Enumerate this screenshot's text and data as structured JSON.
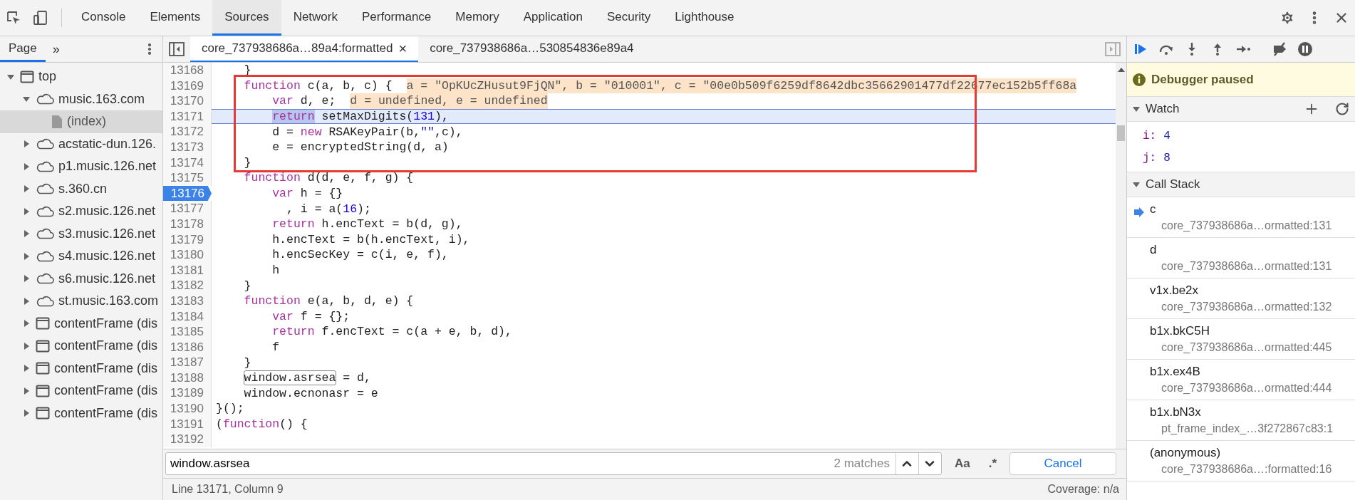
{
  "main_tabs": [
    {
      "label": "Console",
      "selected": false
    },
    {
      "label": "Elements",
      "selected": false
    },
    {
      "label": "Sources",
      "selected": true
    },
    {
      "label": "Network",
      "selected": false
    },
    {
      "label": "Performance",
      "selected": false
    },
    {
      "label": "Memory",
      "selected": false
    },
    {
      "label": "Application",
      "selected": false
    },
    {
      "label": "Security",
      "selected": false
    },
    {
      "label": "Lighthouse",
      "selected": false
    }
  ],
  "navigator": {
    "tab": {
      "label": "Page",
      "selected": true
    },
    "more_tabs": "»",
    "tree": [
      {
        "label": "top",
        "kind": "frame",
        "expanded": true,
        "selected": false,
        "children": [
          {
            "label": "music.163.com",
            "kind": "cloud",
            "expanded": true,
            "selected": false,
            "children": [
              {
                "label": "(index)",
                "kind": "file",
                "selected": true
              }
            ]
          },
          {
            "label": "acstatic-dun.126.",
            "kind": "cloud",
            "expanded": false,
            "selected": false
          },
          {
            "label": "p1.music.126.net",
            "kind": "cloud",
            "expanded": false,
            "selected": false
          },
          {
            "label": "s.360.cn",
            "kind": "cloud",
            "expanded": false,
            "selected": false
          },
          {
            "label": "s2.music.126.net",
            "kind": "cloud",
            "expanded": false,
            "selected": false
          },
          {
            "label": "s3.music.126.net",
            "kind": "cloud",
            "expanded": false,
            "selected": false
          },
          {
            "label": "s4.music.126.net",
            "kind": "cloud",
            "expanded": false,
            "selected": false
          },
          {
            "label": "s6.music.126.net",
            "kind": "cloud",
            "expanded": false,
            "selected": false
          },
          {
            "label": "st.music.163.com",
            "kind": "cloud",
            "expanded": false,
            "selected": false
          },
          {
            "label": "contentFrame (dis",
            "kind": "frame",
            "expanded": false,
            "selected": false
          },
          {
            "label": "contentFrame (dis",
            "kind": "frame",
            "expanded": false,
            "selected": false
          },
          {
            "label": "contentFrame (dis",
            "kind": "frame",
            "expanded": false,
            "selected": false
          },
          {
            "label": "contentFrame (dis",
            "kind": "frame",
            "expanded": false,
            "selected": false
          },
          {
            "label": "contentFrame (dis",
            "kind": "frame",
            "expanded": false,
            "selected": false
          }
        ]
      }
    ]
  },
  "editor_tabs": [
    {
      "label": "core_737938686a…89a4:formatted",
      "selected": true,
      "close": "×"
    },
    {
      "label": "core_737938686a…530854836e89a4",
      "selected": false
    }
  ],
  "lines": [
    {
      "number": "13168",
      "current": false,
      "breakpoint": false,
      "segments": [
        {
          "kind": "plain",
          "text": "    }"
        }
      ]
    },
    {
      "number": "13169",
      "current": false,
      "breakpoint": false,
      "segments": [
        {
          "kind": "keyword",
          "text": "    function"
        },
        {
          "kind": "plain",
          "text": " c(a, b, c) {"
        },
        {
          "kind": "value",
          "text": "a = \"OpKUcZHusut9FjQN\", b = \"010001\", c = \"00e0b509f6259df8642dbc35662901477df22677ec152b5ff68a"
        }
      ]
    },
    {
      "number": "13170",
      "current": false,
      "breakpoint": false,
      "segments": [
        {
          "kind": "keyword",
          "text": "        var"
        },
        {
          "kind": "plain",
          "text": " d, e;"
        },
        {
          "kind": "value",
          "text": "d = undefined, e = undefined"
        }
      ]
    },
    {
      "number": "13171",
      "current": true,
      "breakpoint": false,
      "segments": [
        {
          "kind": "execution",
          "text": "        return"
        },
        {
          "kind": "plain",
          "text": " setMaxDigits("
        },
        {
          "kind": "number",
          "text": "131"
        },
        {
          "kind": "plain",
          "text": "),"
        }
      ]
    },
    {
      "number": "13172",
      "current": false,
      "breakpoint": false,
      "segments": [
        {
          "kind": "plain",
          "text": "        d = "
        },
        {
          "kind": "keyword",
          "text": "new"
        },
        {
          "kind": "plain",
          "text": " RSAKeyPair(b,"
        },
        {
          "kind": "string",
          "text": "\"\""
        },
        {
          "kind": "plain",
          "text": ",c),"
        }
      ]
    },
    {
      "number": "13173",
      "current": false,
      "breakpoint": false,
      "segments": [
        {
          "kind": "plain",
          "text": "        e = encryptedString(d, a)"
        }
      ]
    },
    {
      "number": "13174",
      "current": false,
      "breakpoint": false,
      "segments": [
        {
          "kind": "plain",
          "text": "    }"
        }
      ]
    },
    {
      "number": "13175",
      "current": false,
      "breakpoint": false,
      "segments": [
        {
          "kind": "keyword",
          "text": "    function"
        },
        {
          "kind": "plain",
          "text": " d(d, e, f, g) {"
        }
      ]
    },
    {
      "number": "13176",
      "current": false,
      "breakpoint": true,
      "segments": [
        {
          "kind": "keyword",
          "text": "        var"
        },
        {
          "kind": "plain",
          "text": " h = {}"
        }
      ]
    },
    {
      "number": "13177",
      "current": false,
      "breakpoint": false,
      "segments": [
        {
          "kind": "plain",
          "text": "          , i = a("
        },
        {
          "kind": "number",
          "text": "16"
        },
        {
          "kind": "plain",
          "text": ");"
        }
      ]
    },
    {
      "number": "13178",
      "current": false,
      "breakpoint": false,
      "segments": [
        {
          "kind": "keyword",
          "text": "        return"
        },
        {
          "kind": "plain",
          "text": " h.encText = b(d, g),"
        }
      ]
    },
    {
      "number": "13179",
      "current": false,
      "breakpoint": false,
      "segments": [
        {
          "kind": "plain",
          "text": "        h.encText = b(h.encText, i),"
        }
      ]
    },
    {
      "number": "13180",
      "current": false,
      "breakpoint": false,
      "segments": [
        {
          "kind": "plain",
          "text": "        h.encSecKey = c(i, e, f),"
        }
      ]
    },
    {
      "number": "13181",
      "current": false,
      "breakpoint": false,
      "segments": [
        {
          "kind": "plain",
          "text": "        h"
        }
      ]
    },
    {
      "number": "13182",
      "current": false,
      "breakpoint": false,
      "segments": [
        {
          "kind": "plain",
          "text": "    }"
        }
      ]
    },
    {
      "number": "13183",
      "current": false,
      "breakpoint": false,
      "segments": [
        {
          "kind": "keyword",
          "text": "    function"
        },
        {
          "kind": "plain",
          "text": " e(a, b, d, e) {"
        }
      ]
    },
    {
      "number": "13184",
      "current": false,
      "breakpoint": false,
      "segments": [
        {
          "kind": "keyword",
          "text": "        var"
        },
        {
          "kind": "plain",
          "text": " f = {};"
        }
      ]
    },
    {
      "number": "13185",
      "current": false,
      "breakpoint": false,
      "segments": [
        {
          "kind": "keyword",
          "text": "        return"
        },
        {
          "kind": "plain",
          "text": " f.encText = c(a + e, b, d),"
        }
      ]
    },
    {
      "number": "13186",
      "current": false,
      "breakpoint": false,
      "segments": [
        {
          "kind": "plain",
          "text": "        f"
        }
      ]
    },
    {
      "number": "13187",
      "current": false,
      "breakpoint": false,
      "segments": [
        {
          "kind": "plain",
          "text": "    }"
        }
      ]
    },
    {
      "number": "13188",
      "current": false,
      "breakpoint": false,
      "segments": [
        {
          "kind": "match",
          "text": "    window.asrsea"
        },
        {
          "kind": "plain",
          "text": " = d,"
        }
      ]
    },
    {
      "number": "13189",
      "current": false,
      "breakpoint": false,
      "segments": [
        {
          "kind": "plain",
          "text": "    window.ecnonasr = e"
        }
      ]
    },
    {
      "number": "13190",
      "current": false,
      "breakpoint": false,
      "segments": [
        {
          "kind": "plain",
          "text": "}();"
        }
      ]
    },
    {
      "number": "13191",
      "current": false,
      "breakpoint": false,
      "segments": [
        {
          "kind": "plain",
          "text": "("
        },
        {
          "kind": "keyword",
          "text": "function"
        },
        {
          "kind": "plain",
          "text": "() {"
        }
      ]
    },
    {
      "number": "13192",
      "current": false,
      "breakpoint": false
    }
  ],
  "search": {
    "value": "window.asrsea",
    "matches": "2 matches",
    "case_button": "Aa",
    "regex_button": ".*",
    "cancel": "Cancel"
  },
  "status_bar": {
    "position": "Line 13171, Column 9",
    "coverage": "Coverage: n/a"
  },
  "debugger": {
    "banner": "Debugger paused",
    "watch": {
      "title": "Watch",
      "expanded": true,
      "items": [
        {
          "name": "i:",
          "value": "4"
        },
        {
          "name": "j:",
          "value": "8"
        }
      ]
    },
    "call_stack": {
      "title": "Call Stack",
      "expanded": true,
      "frames": [
        {
          "name": "c",
          "location": "core_737938686a…ormatted:131",
          "selected": true
        },
        {
          "name": "d",
          "location": "core_737938686a…ormatted:131",
          "selected": false
        },
        {
          "name": "v1x.be2x",
          "location": "core_737938686a…ormatted:132",
          "selected": false
        },
        {
          "name": "b1x.bkC5H",
          "location": "core_737938686a…ormatted:445",
          "selected": false
        },
        {
          "name": "b1x.ex4B",
          "location": "core_737938686a…ormatted:444",
          "selected": false
        },
        {
          "name": "b1x.bN3x",
          "location": "pt_frame_index_…3f272867c83:1",
          "selected": false
        },
        {
          "name": "(anonymous)",
          "location": "core_737938686a…:formatted:16",
          "selected": false
        }
      ]
    }
  }
}
